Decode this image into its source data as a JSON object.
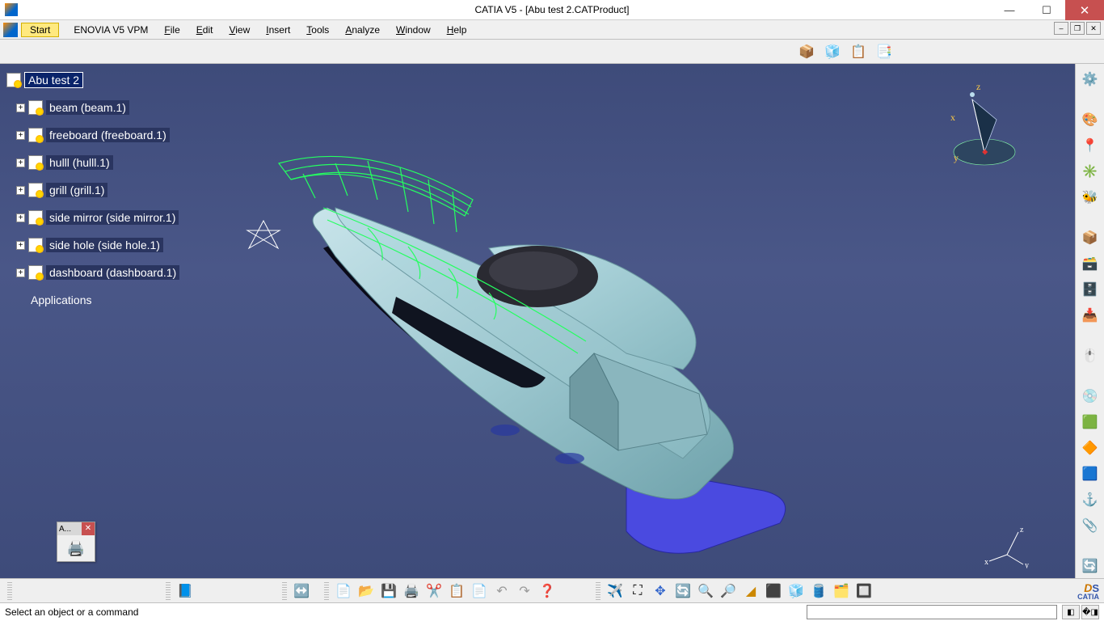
{
  "title": "CATIA V5 - [Abu test 2.CATProduct]",
  "menu": {
    "start": "Start",
    "items": [
      "ENOVIA V5 VPM",
      "File",
      "Edit",
      "View",
      "Insert",
      "Tools",
      "Analyze",
      "Window",
      "Help"
    ]
  },
  "tree": {
    "root": "Abu test 2",
    "children": [
      "beam (beam.1)",
      "freeboard (freeboard.1)",
      "hulll (hulll.1)",
      "grill (grill.1)",
      "side mirror (side mirror.1)",
      "side hole (side hole.1)",
      "dashboard (dashboard.1)"
    ],
    "last": "Applications"
  },
  "float_toolbar": {
    "title": "A..."
  },
  "compass": {
    "x": "x",
    "y": "y",
    "z": "z"
  },
  "triad": {
    "x": "x",
    "y": "y",
    "z": "z"
  },
  "status": {
    "msg": "Select an object or a command"
  },
  "logo": {
    "brand": "CATIA"
  },
  "top_icons": [
    "cube-add",
    "cube-multi",
    "list-left",
    "list-right"
  ],
  "right_icons_a": [
    "gear"
  ],
  "right_icons_b": [
    "palette",
    "globe-pin",
    "axis-arrows",
    "bee"
  ],
  "right_icons_c": [
    "box1",
    "box2",
    "box3",
    "box4"
  ],
  "right_icons_d": [
    "cursor-star"
  ],
  "right_icons_e": [
    "disc",
    "cube-green",
    "diamond",
    "cube-blue",
    "anchor",
    "clip"
  ],
  "right_icons_f": [
    "orbit"
  ],
  "bottom_icons_a": [
    "book-blue"
  ],
  "bottom_icons_b": [
    "arrows-orange"
  ],
  "bottom_icons_c": [
    "new",
    "open",
    "save",
    "print",
    "cut",
    "copy",
    "paste",
    "undo",
    "redo",
    "help-arrow"
  ],
  "bottom_icons_d": [
    "plane",
    "fit",
    "pan",
    "rotate",
    "zoom-in",
    "zoom-out",
    "normal",
    "iso",
    "shade",
    "cylinder",
    "layers",
    "toggle"
  ]
}
